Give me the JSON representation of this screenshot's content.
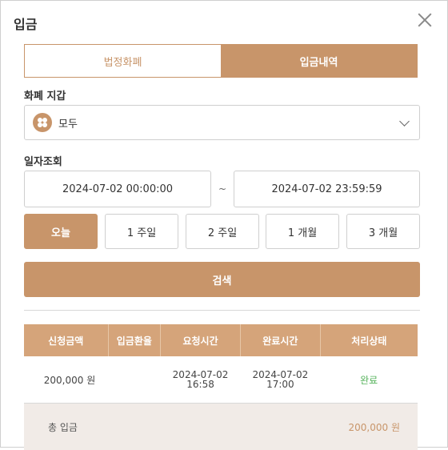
{
  "modal": {
    "title": "입금",
    "close": "close"
  },
  "tabs": [
    {
      "label": "법정화폐",
      "active": false
    },
    {
      "label": "입금내역",
      "active": true
    }
  ],
  "wallet": {
    "label": "화폐 지갑",
    "selected": "모두"
  },
  "date_query": {
    "label": "일자조회",
    "from": "2024-07-02 00:00:00",
    "separator": "~",
    "to": "2024-07-02 23:59:59"
  },
  "range_buttons": [
    {
      "label": "오늘",
      "active": true
    },
    {
      "label": "1 주일",
      "active": false
    },
    {
      "label": "2 주일",
      "active": false
    },
    {
      "label": "1 개월",
      "active": false
    },
    {
      "label": "3 개월",
      "active": false
    }
  ],
  "search": {
    "label": "검색"
  },
  "table": {
    "headers": [
      "신청금액",
      "입금환율",
      "요청시간",
      "완료시간",
      "처리상태"
    ],
    "rows": [
      {
        "amount": "200,000 원",
        "rate": "",
        "request_time": "2024-07-02\n16:58",
        "complete_time": "2024-07-02\n17:00",
        "status": "완료"
      }
    ],
    "footer": {
      "label": "총 입금",
      "total": "200,000 원"
    }
  },
  "colors": {
    "accent": "#c8956a",
    "header_bg": "#d5a47a",
    "footer_bg": "#f1ebe7",
    "status_done": "#56b35c"
  }
}
